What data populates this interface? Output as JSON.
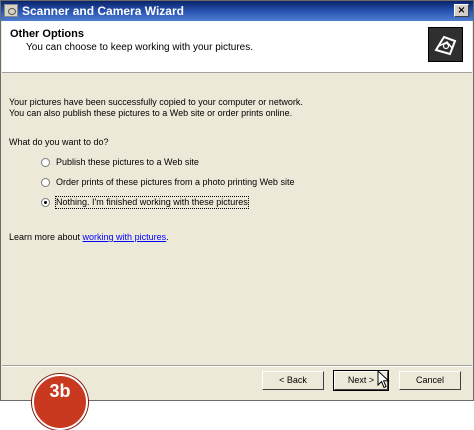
{
  "window": {
    "title": "Scanner and Camera Wizard",
    "close_label": "×"
  },
  "header": {
    "title": "Other Options",
    "subtitle": "You can choose to keep working with your pictures."
  },
  "body": {
    "message_line1": "Your pictures have been successfully copied to your computer or network.",
    "message_line2": "You can also publish these pictures to a Web site or order prints online.",
    "question": "What do you want to do?",
    "options": [
      {
        "label": "Publish these pictures to a Web site",
        "selected": false
      },
      {
        "label": "Order prints of these pictures from a photo printing Web site",
        "selected": false
      },
      {
        "label": "Nothing. I'm finished working with these pictures",
        "selected": true
      }
    ],
    "learn_more_prefix": "Learn more about ",
    "learn_more_link": "working with pictures",
    "learn_more_suffix": "."
  },
  "buttons": {
    "back": "< Back",
    "next": "Next >",
    "cancel": "Cancel"
  },
  "badge": {
    "text": "3b"
  }
}
